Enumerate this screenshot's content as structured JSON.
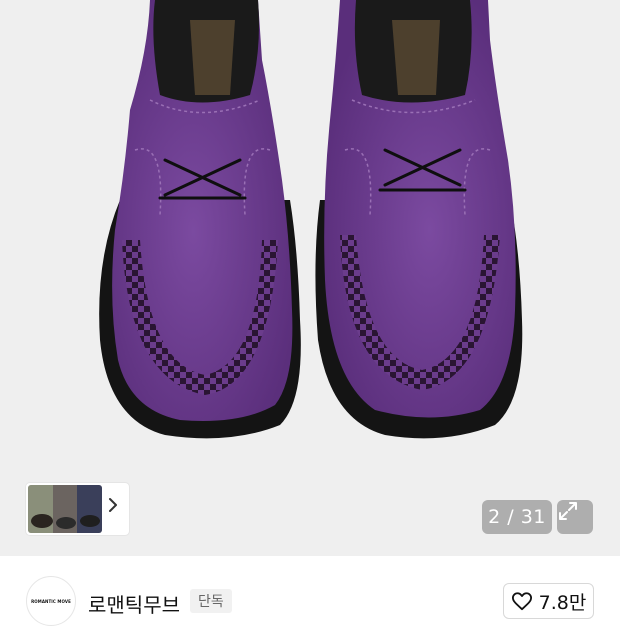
{
  "product_image": {
    "alt_subject": "purple-suede-shoes",
    "colors": {
      "suede": "#6a3a8c",
      "sole": "#111111",
      "background": "#efefef"
    }
  },
  "gallery": {
    "counter": "2 / 31",
    "thumbnail_icon": "chevron-right-icon",
    "expand_icon": "expand-icon"
  },
  "brand": {
    "logo_text": "ROMANTIC MOVE",
    "name": "로맨틱무브",
    "badge": "단독"
  },
  "like": {
    "icon": "heart-icon",
    "count": "7.8만"
  }
}
